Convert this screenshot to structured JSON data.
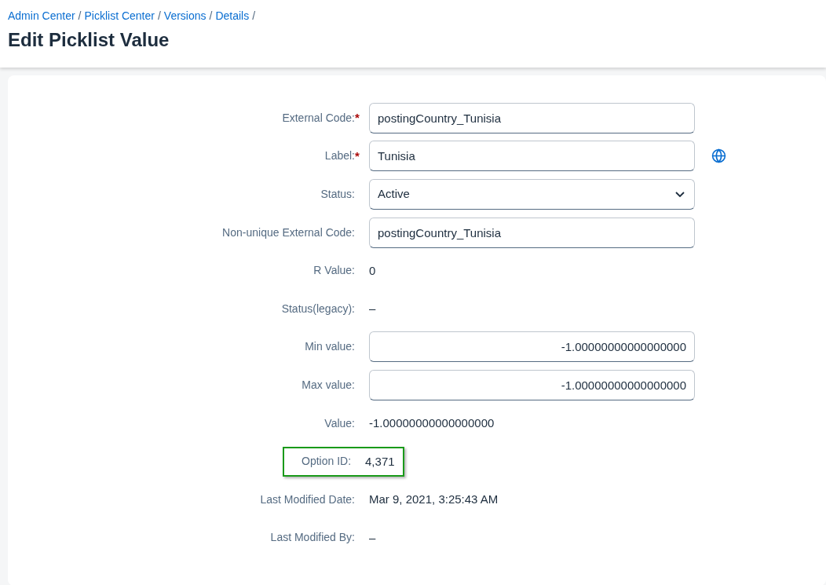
{
  "breadcrumbs": [
    {
      "label": "Admin Center",
      "separator": "/"
    },
    {
      "label": "Picklist Center",
      "separator": "/"
    },
    {
      "label": "Versions",
      "separator": "/"
    },
    {
      "label": "Details",
      "separator": "/"
    }
  ],
  "title": "Edit Picklist Value",
  "fields": [
    {
      "label": "External Code:",
      "required_mark": "*",
      "kind": "input",
      "value": "postingCountry_Tunisia",
      "highlighted": false
    },
    {
      "label": "Label:",
      "required_mark": "*",
      "kind": "input",
      "value": "Tunisia",
      "translatable": true,
      "highlighted": false
    },
    {
      "label": "Status:",
      "kind": "select",
      "value": "Active",
      "highlighted": false
    },
    {
      "label": "Non-unique External Code:",
      "kind": "input",
      "value": "postingCountry_Tunisia",
      "highlighted": false
    },
    {
      "label": "R Value:",
      "kind": "text",
      "value": "0",
      "highlighted": false
    },
    {
      "label": "Status(legacy):",
      "kind": "text",
      "value": "–",
      "highlighted": false
    },
    {
      "label": "Min value:",
      "kind": "number",
      "value": "-1.00000000000000000",
      "highlighted": false
    },
    {
      "label": "Max value:",
      "kind": "number",
      "value": "-1.00000000000000000",
      "highlighted": false
    },
    {
      "label": "Value:",
      "kind": "text",
      "value": "-1.00000000000000000",
      "highlighted": false
    },
    {
      "label": "Option ID:",
      "kind": "text",
      "value": "4,371",
      "highlighted": true
    },
    {
      "label": "Last Modified Date:",
      "kind": "text",
      "value": "Mar 9, 2021, 3:25:43 AM",
      "highlighted": false
    },
    {
      "label": "Last Modified By:",
      "kind": "text",
      "value": "–",
      "highlighted": false
    }
  ]
}
